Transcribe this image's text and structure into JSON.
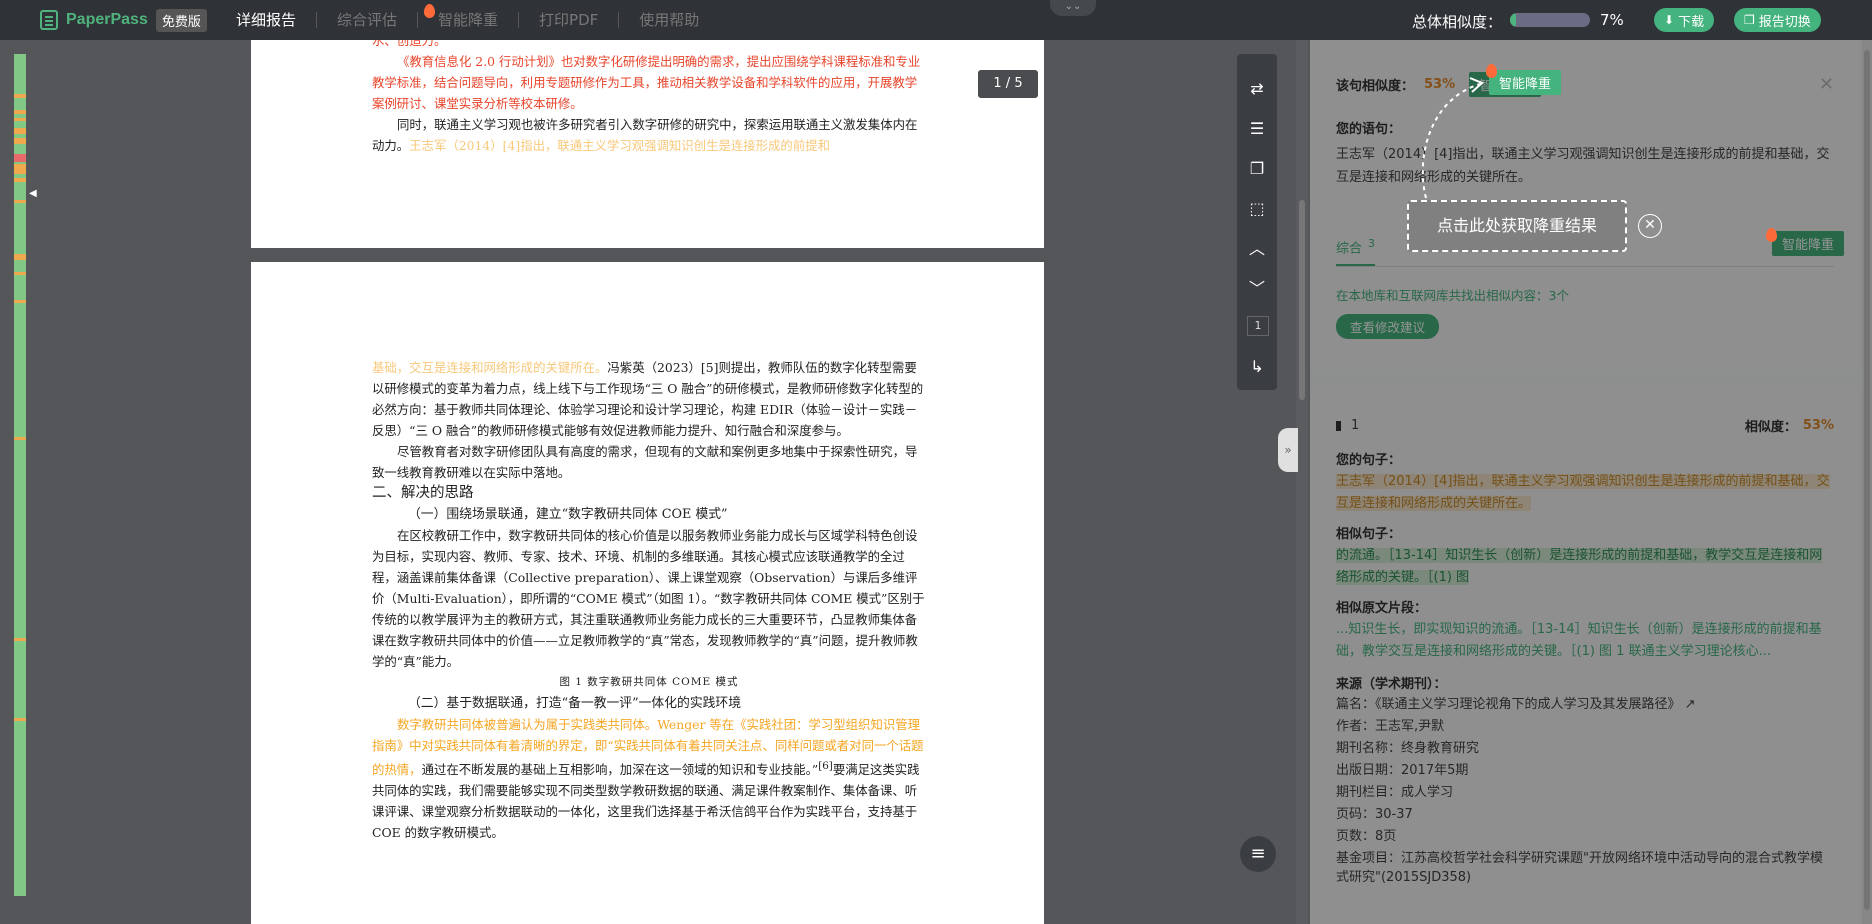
{
  "topbar": {
    "brand": "PaperPass",
    "badge": "免费版",
    "nav": [
      "详细报告",
      "综合评估",
      "智能降重",
      "打印PDF",
      "使用帮助"
    ],
    "similarity_label": "总体相似度：",
    "similarity_value": "7%",
    "similarity_fraction": 0.07,
    "download_label": "下载",
    "switch_label": "报告切换",
    "collapse_icon": "double-chevron-down"
  },
  "viewer": {
    "page_indicator": "1 / 5",
    "current_page_box": "1",
    "page1": {
      "cut_line": "水、创造力。",
      "para1": "《教育信息化 2.0 行动计划》也对数字化研修提出明确的需求，提出应围绕学科课程标准和专业教学标准，结合问题导向，利用专题研修作为工具，推动相关教学设备和学科软件的应用，开展教学案例研讨、课堂实录分析等校本研修。",
      "para2_a": "同时，联通主义学习观也被许多研究者引入数字研修的研究中，探索运用联通主义激发集体内在动力。",
      "para2_b": "王志军（2014）[4]指出，联通主义学习观强调知识创生是连接形成的前提和"
    },
    "page2": {
      "p1_a": "基础，交互是连接和网络形成的关键所在。",
      "p1_b": "冯紫英（2023）[5]则提出，教师队伍的数字化转型需要以研修模式的变革为着力点，线上线下与工作现场“三 O 融合”的研修模式，是教师研修数字化转型的必然方向：基于教师共同体理论、体验学习理论和设计学习理论，构建 EDIR（体验－设计－实践－反思）“三 O 融合”的教师研修模式能够有效促进教师能力提升、知行融合和深度参与。",
      "p2": "尽管教育者对数字研修团队具有高度的需求，但现有的文献和案例更多地集中于探索性研究，导致一线教育教研难以在实际中落地。",
      "h2": "二、解决的思路",
      "h3_1": "（一）围绕场景联通，建立“数字教研共同体 COE 模式”",
      "p3": "在区校教研工作中，数字教研共同体的核心价值是以服务教师业务能力成长与区域学科特色创设为目标，实现内容、教师、专家、技术、环境、机制的多维联通。其核心模式应该联通教学的全过程，涵盖课前集体备课（Collective preparation）、课上课堂观察（Observation）与课后多维评价（Multi-Evaluation），即所谓的“COME 模式”（如图 1）。“数字教研共同体 COME 模式”区别于传统的以教学展评为主的教研方式，其注重联通教师业务能力成长的三大重要环节，凸显教师集体备课在数字教研共同体中的价值——立足教师教学的“真”常态，发现教师教学的“真”问题，提升教师教学的“真”能力。",
      "caption": "图 1  数字教研共同体 COME 模式",
      "h3_2": "（二）基于数据联通，打造“备一教一评”一体化的实践环境",
      "p4_a": "数字教研共同体被普遍认为属于实践类共同体。Wenger 等在《实践社团：学习型组织知识管理指南》中对实践共同体有着清晰的界定，即“实践共同体有着共同关注点、同样问题或者对同一个话题的热情，",
      "p4_b": "通过在不断发展的基础上互相影响，加深在这一领域的知识和专业技能。”",
      "p4_sup": "[6]",
      "p4_c": "要满足这类实践共同体的实践，我们需要能够实现不同类型数学教研数据的联通、满足课件教案制作、集体备课、听课评课、课堂观察分析数据联动的一体化，这里我们选择基于希沃信鸽平台作为实践平台，支持基于 COE 的数字教研模式。"
    },
    "tools": [
      "swap-icon",
      "list-icon",
      "copy-icon",
      "select-icon",
      "chevron-up-icon",
      "chevron-down-icon",
      "page-box",
      "jump-icon"
    ]
  },
  "panel": {
    "sentence_sim_label": "该句相似度：",
    "sentence_sim_value": "53%",
    "smart_button": "智能降重",
    "your_sentence_label": "您的语句：",
    "your_sentence": "王志军（2014）[4]指出，联通主义学习观强调知识创生是连接形成的前提和基础，交互是连接和网络形成的关键所在。",
    "tab_label": "综合",
    "tab_count": "3",
    "tab_smart": "智能降重",
    "found_text": "在本地库和互联网库共找出相似内容：3个",
    "view_suggestion": "查看修改建议",
    "item_index": "1",
    "item_sim_label": "相似度：",
    "item_sim_value": "53%",
    "your_sentence2_label": "您的句子：",
    "your_sentence2": "王志军（2014）[4]指出，联通主义学习观强调知识创生是连接形成的前提和基础，交互是连接和网络形成的关键所在。",
    "similar_label": "相似句子：",
    "similar_text": "的流通。［13-14］知识生长（创新）是连接形成的前提和基础，教学交互是连接和网络形成的关键。［(1) 图",
    "fragment_label": "相似原文片段：",
    "fragment_text": "...知识生长，即实现知识的流通。［13-14］知识生长（创新）是连接形成的前提和基础，教学交互是连接和网络形成的关键。［(1) 图 1 联通主义学习理论核心...",
    "source_label": "来源（学术期刊）：",
    "source": [
      {
        "k": "篇名：",
        "v": "《联通主义学习理论视角下的成人学习及其发展路径》"
      },
      {
        "k": "作者：",
        "v": "王志军,尹默"
      },
      {
        "k": "期刊名称：",
        "v": "终身教育研究"
      },
      {
        "k": "出版日期：",
        "v": "2017年5期"
      },
      {
        "k": "期刊栏目：",
        "v": "成人学习"
      },
      {
        "k": "页码：",
        "v": "30-37"
      },
      {
        "k": "页数：",
        "v": "8页"
      },
      {
        "k": "基金项目：",
        "v": "江苏高校哲学社会科学研究课题\"开放网络环境中活动导向的混合式教学模式研究\"(2015SJD358)"
      }
    ],
    "tooltip": "点击此处获取降重结果"
  },
  "colors": {
    "accent": "#45b37e",
    "topbar": "#2f3236",
    "warn": "#e8452b",
    "orange": "#f5a623"
  }
}
